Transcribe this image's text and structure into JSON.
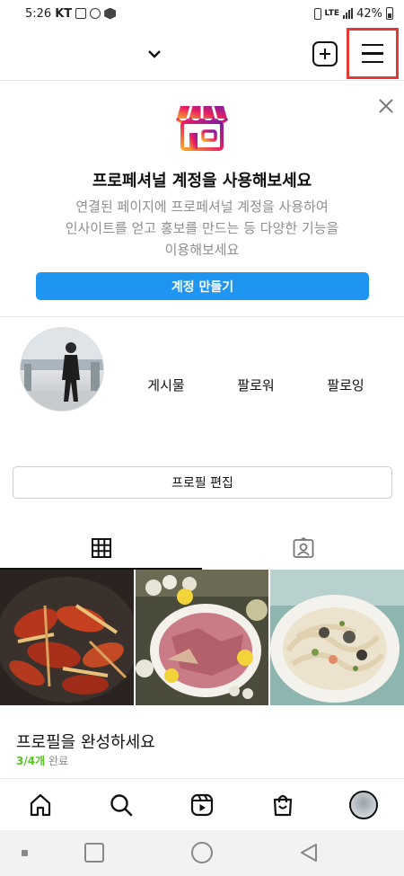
{
  "status_bar": {
    "time": "5:26",
    "carrier": "KT",
    "network": "LTE",
    "battery": "42%"
  },
  "top_bar": {
    "username": "",
    "icons": [
      "chevron-down-icon",
      "new-post-icon",
      "menu-icon"
    ]
  },
  "promo": {
    "title": "프로페셔널 계정을 사용해보세요",
    "description_lines": [
      "연결된 페이지에 프로페셔널 계정을 사용하여",
      "인사이트를 얻고 홍보를 만드는 등 다양한 기능을",
      "이용해보세요"
    ],
    "button_label": "계정 만들기",
    "button_color": "#1e95f0"
  },
  "profile": {
    "stats": [
      {
        "label": "게시물"
      },
      {
        "label": "팔로워"
      },
      {
        "label": "팔로잉"
      }
    ],
    "edit_button_label": "프로필 편집"
  },
  "tabs": [
    {
      "name": "grid",
      "icon": "grid-icon"
    },
    {
      "name": "tagged",
      "icon": "tagged-icon"
    }
  ],
  "grid_posts": [
    {
      "subject": "spicy stir-fried dumplings"
    },
    {
      "subject": "sashimi platter"
    },
    {
      "subject": "cream pasta"
    }
  ],
  "completion": {
    "title": "프로필을 완성하세요",
    "progress_done": "3/4개",
    "progress_suffix": "완료"
  },
  "bottom_nav": [
    "home-icon",
    "search-icon",
    "reels-icon",
    "shop-icon",
    "profile-avatar"
  ],
  "colors": {
    "accent": "#1e95f0",
    "highlight_box": "#e53935",
    "progress_green": "#58c322"
  }
}
